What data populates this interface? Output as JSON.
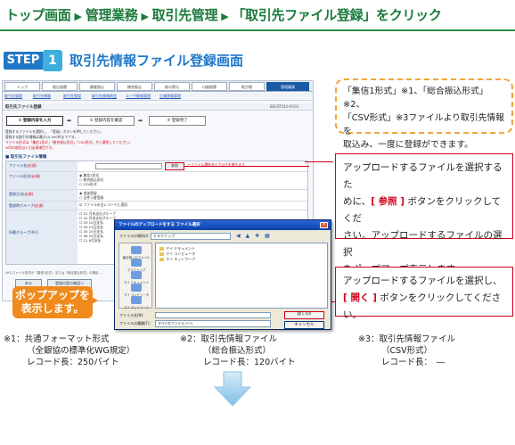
{
  "breadcrumb": {
    "items": [
      "トップ画面",
      "管理業務",
      "取引先管理",
      "「取引先ファイル登録」をクリック"
    ],
    "separator": "▶"
  },
  "step": {
    "label": "STEP",
    "number": "1",
    "title": "取引先情報ファイル登録画面"
  },
  "app": {
    "nav_tabs": [
      "トップ",
      "振込振替",
      "都度振込",
      "総合振込",
      "給与賞与",
      "口座振替",
      "地方税",
      "管理業務"
    ],
    "sub_links": [
      "取引先管理",
      "取引先情報",
      "取引先登録",
      "取引先情報照会",
      "ユーザ情報管理",
      "企業情報管理"
    ],
    "page_title": "取引先ファイル登録",
    "page_code": "BSCRT010-R101",
    "flow_steps": [
      "① 登録内容を入力",
      "② 登録内容を確認",
      "③ 登録完了"
    ],
    "notes": [
      "登録するファイルを選択し、「登録」ボタンを押してください。",
      "登録する取引先情報は最大10,000件までです。",
      "ファイル形式は「集信1形式」「総合振込形式」「CSV形式」から選択してください。",
      "※印の項目は入力必須項目です。"
    ],
    "section_title": "■ 取引先ファイル情報",
    "form": {
      "file_label": "ファイル名",
      "file_req": "(必須)",
      "browse_label": "参照",
      "browse_hint": "←ファイル選択ダイアログを開きます",
      "format_label": "ファイル形式",
      "format_req": "(必須)",
      "format_options": [
        "◉ 集信1形式",
        "○ 総合振込形式",
        "○ CSV形式"
      ],
      "method_label": "登録方法",
      "method_req": "(必須)",
      "method_options": [
        "◉ 追加登録",
        "○ 全件入替登録"
      ],
      "group_label": "登録時グループ",
      "group_req": "(必須)",
      "group_options": [
        "☑ ファイルの全レコードに適用",
        "☐ 01 月末支払グループ",
        "☐ 02 月末支払グループ",
        "☐ 03 10日支払",
        "☐ 04 15日支払",
        "☐ 05 20日支払",
        "☐ 06 25日支払",
        "☐ 11 6月支払"
      ],
      "member_label": "所属グループ(※1)"
    },
    "footnote": "(※1)ファイル形式が「集信1形式」または「総合振込形式」の場合 ...",
    "back_button": "戻る",
    "register_button": "登録内容の確認へ"
  },
  "dialog": {
    "title": "ファイルのアップロードをする ファイル選択",
    "look_in_label": "ファイルの場所(I):",
    "look_in_value": "デスクトップ",
    "toolbar_icons": "◀ ▲ ✚ ▦",
    "places": [
      "最近使ったファイル",
      "デスクトップ",
      "マイ ドキュメント",
      "マイ コンピュータ",
      "マイ ネットワーク"
    ],
    "files": [
      "マイ ドキュメント",
      "マイ コンピュータ",
      "マイ ネットワーク"
    ],
    "filename_label": "ファイル名(N):",
    "filename_value": "",
    "filetype_label": "ファイルの種類(T):",
    "filetype_value": "すべてのファイル (*.*)",
    "open_button": "開く(O)",
    "cancel_button": "キャンセル"
  },
  "bubble": {
    "line1": "ポップアップを",
    "line2": "表示します。"
  },
  "info_box": {
    "line1": "「集信1形式」※1、「総合振込形式」※2、",
    "line2": "「CSV形式」※3ファイルより取引先情報を",
    "line3": "取込み、一度に登録ができます。"
  },
  "callout_browse": {
    "part1": "アップロードするファイルを選択するた",
    "part2a": "めに、",
    "highlight": "[ 参照 ]",
    "part2b": " ボタンをクリックしてくだ",
    "part3": "さい。アップロードするファイルの選択",
    "part4": "をポップアップ表示します。"
  },
  "callout_open": {
    "part1": "アップロードするファイルを選択し、",
    "highlight": "[ 開く ]",
    "part2": " ボタンをクリックしてください。"
  },
  "footnotes": [
    {
      "mark": "※1：",
      "line1": "共通フォーマット形式",
      "line2": "（全銀協の標準化WG規定）",
      "line3": "レコード長：250バイト"
    },
    {
      "mark": "※2：",
      "line1": "取引先情報ファイル",
      "line2": "（総合振込形式）",
      "line3": "レコード長：120バイト"
    },
    {
      "mark": "※3：",
      "line1": "取引先情報ファイル",
      "line2": "（CSV形式）",
      "line3": "レコード長：　―"
    }
  ],
  "colors": {
    "green": "#1a7a3a",
    "blue": "#1f78c8",
    "red": "#d0021b",
    "orange": "#f08a1c"
  }
}
